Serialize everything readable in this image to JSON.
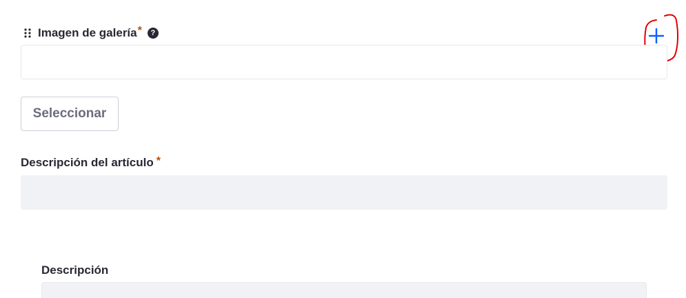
{
  "gallery_field": {
    "label": "Imagen de galería",
    "required_mark": "*",
    "help_icon_glyph": "?",
    "drag_icon": "drag-handle-icon",
    "add_icon": "plus-icon",
    "input_value": "",
    "select_button_label": "Seleccionar"
  },
  "article_description_field": {
    "label": "Descripción del artículo",
    "required_mark": "*",
    "input_value": ""
  },
  "description_field": {
    "label": "Descripción",
    "input_value": ""
  },
  "colors": {
    "required": "#b95000",
    "accent": "#0b5fff",
    "annotation": "#e00000",
    "input_bg": "#f1f2f5"
  }
}
